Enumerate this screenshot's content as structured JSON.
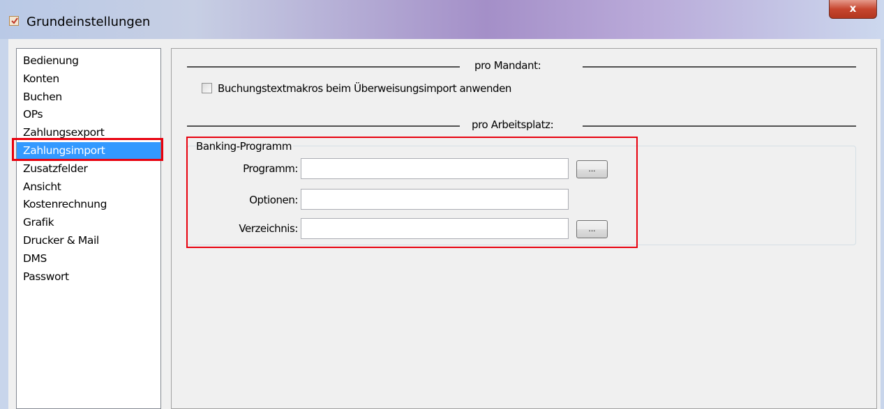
{
  "window": {
    "title": "Grundeinstellungen",
    "close_label": "x",
    "icon": "settings-checklist-icon"
  },
  "sidebar": {
    "items": [
      {
        "label": "Bedienung"
      },
      {
        "label": "Konten"
      },
      {
        "label": "Buchen"
      },
      {
        "label": "OPs"
      },
      {
        "label": "Zahlungsexport"
      },
      {
        "label": "Zahlungsimport",
        "selected": true
      },
      {
        "label": "Zusatzfelder"
      },
      {
        "label": "Ansicht"
      },
      {
        "label": "Kostenrechnung"
      },
      {
        "label": "Grafik"
      },
      {
        "label": "Drucker & Mail"
      },
      {
        "label": "DMS"
      },
      {
        "label": "Passwort"
      }
    ]
  },
  "main": {
    "pro_mandant": {
      "label": "pro Mandant:",
      "checkbox_label": "Buchungstextmakros beim Überweisungsimport anwenden",
      "checkbox_checked": false
    },
    "pro_arbeitsplatz": {
      "label": "pro Arbeitsplatz:"
    },
    "banking_group": {
      "title": "Banking-Programm",
      "fields": {
        "programm": {
          "label": "Programm:",
          "value": ""
        },
        "optionen": {
          "label": "Optionen:",
          "value": ""
        },
        "verzeichnis": {
          "label": "Verzeichnis:",
          "value": ""
        }
      },
      "browse_label": "..."
    }
  },
  "colors": {
    "selection": "#3399ff",
    "annotation_red": "#e8000d",
    "close_button": "#c7462f"
  }
}
